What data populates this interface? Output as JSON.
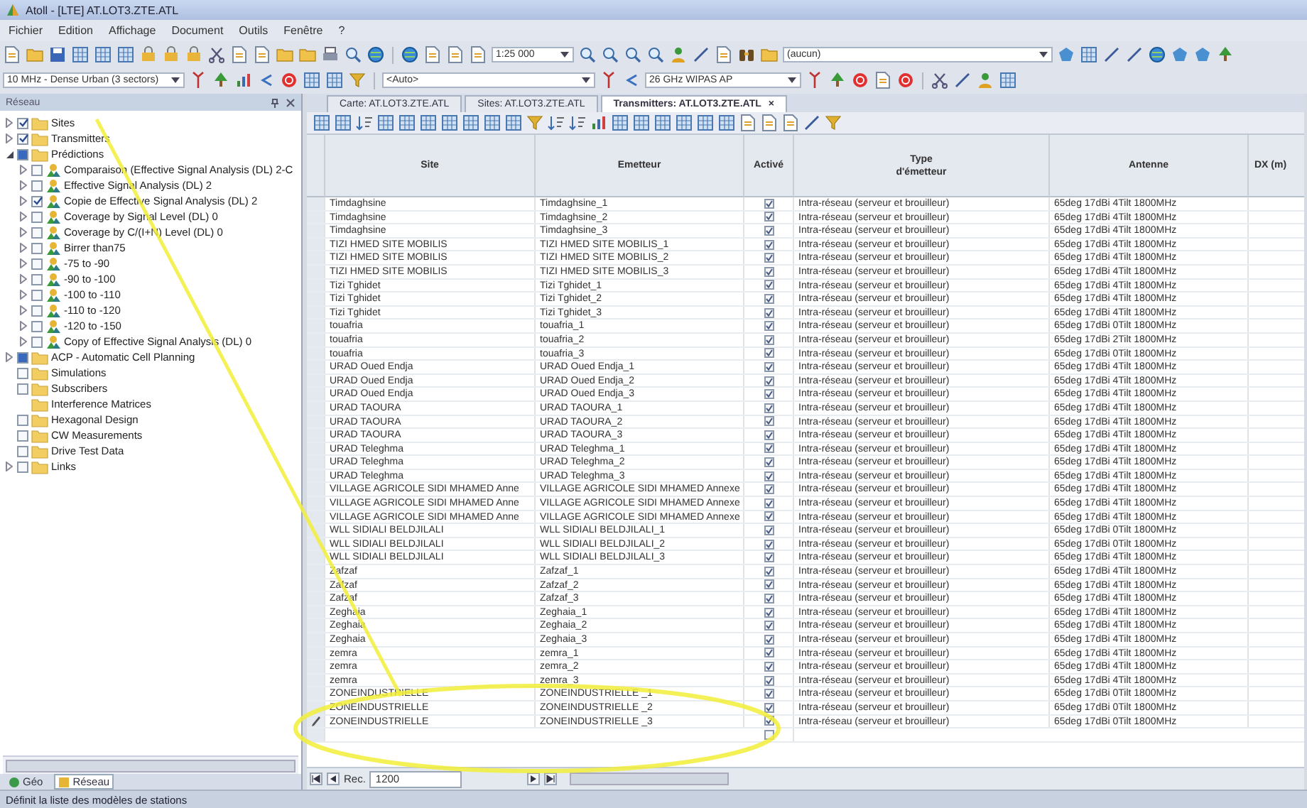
{
  "window": {
    "title": "Atoll - [LTE] AT.LOT3.ZTE.ATL"
  },
  "menu": [
    "Fichier",
    "Edition",
    "Affichage",
    "Document",
    "Outils",
    "Fenêtre",
    "?"
  ],
  "toolbars": {
    "scale": "1:25 000",
    "layer": "(aucun)",
    "environment": "10 MHz - Dense Urban (3 sectors)",
    "auto": "<Auto>",
    "equipment": "26 GHz WIPAS AP"
  },
  "panel": {
    "title": "Réseau",
    "tabs": [
      {
        "label": "Géo",
        "selected": false
      },
      {
        "label": "Réseau",
        "selected": true
      }
    ]
  },
  "tree": [
    {
      "label": "Sites",
      "kind": "folder",
      "checked": true,
      "partial": false,
      "expandable": true,
      "expanded": false
    },
    {
      "label": "Transmitters",
      "kind": "folder",
      "checked": true,
      "partial": false,
      "expandable": true,
      "expanded": false
    },
    {
      "label": "Prédictions",
      "kind": "folder",
      "checked": false,
      "partial": true,
      "expandable": true,
      "expanded": true,
      "children": [
        {
          "label": "Comparaison (Effective Signal Analysis (DL) 2-C",
          "kind": "prediction",
          "checked": false,
          "partial": false,
          "expandable": true,
          "expanded": false
        },
        {
          "label": "Effective Signal Analysis (DL) 2",
          "kind": "prediction",
          "checked": false,
          "partial": false,
          "expandable": true,
          "expanded": false
        },
        {
          "label": "Copie de Effective Signal Analysis (DL) 2",
          "kind": "prediction",
          "checked": true,
          "partial": false,
          "expandable": true,
          "expanded": false
        },
        {
          "label": "Coverage by Signal Level (DL) 0",
          "kind": "prediction",
          "checked": false,
          "partial": false,
          "expandable": true,
          "expanded": false
        },
        {
          "label": "Coverage by C/(I+N) Level (DL) 0",
          "kind": "prediction",
          "checked": false,
          "partial": false,
          "expandable": true,
          "expanded": false
        },
        {
          "label": "Birrer than75",
          "kind": "prediction",
          "checked": false,
          "partial": false,
          "expandable": true,
          "expanded": false
        },
        {
          "label": "-75 to -90",
          "kind": "prediction",
          "checked": false,
          "partial": false,
          "expandable": true,
          "expanded": false
        },
        {
          "label": "-90 to -100",
          "kind": "prediction",
          "checked": false,
          "partial": false,
          "expandable": true,
          "expanded": false
        },
        {
          "label": "-100 to -110",
          "kind": "prediction",
          "checked": false,
          "partial": false,
          "expandable": true,
          "expanded": false
        },
        {
          "label": "-110 to -120",
          "kind": "prediction",
          "checked": false,
          "partial": false,
          "expandable": true,
          "expanded": false
        },
        {
          "label": "-120 to -150",
          "kind": "prediction",
          "checked": false,
          "partial": false,
          "expandable": true,
          "expanded": false
        },
        {
          "label": "Copy of Effective Signal Analysis (DL) 0",
          "kind": "prediction",
          "checked": false,
          "partial": false,
          "expandable": true,
          "expanded": false
        }
      ]
    },
    {
      "label": "ACP - Automatic Cell Planning",
      "kind": "folder",
      "checked": false,
      "partial": true,
      "expandable": true,
      "expanded": false
    },
    {
      "label": "Simulations",
      "kind": "folder",
      "checked": false,
      "partial": false,
      "expandable": false
    },
    {
      "label": "Subscribers",
      "kind": "folder",
      "checked": false,
      "partial": false,
      "expandable": false
    },
    {
      "label": "Interference Matrices",
      "kind": "folder_plain",
      "expandable": false
    },
    {
      "label": "Hexagonal Design",
      "kind": "folder",
      "checked": false,
      "partial": false,
      "expandable": false
    },
    {
      "label": "CW Measurements",
      "kind": "folder",
      "checked": false,
      "partial": false,
      "expandable": false
    },
    {
      "label": "Drive Test Data",
      "kind": "folder",
      "checked": false,
      "partial": false,
      "expandable": false
    },
    {
      "label": "Links",
      "kind": "folder",
      "checked": false,
      "partial": false,
      "expandable": true,
      "expanded": false
    }
  ],
  "doc_tabs": [
    {
      "label": "Carte: AT.LOT3.ZTE.ATL",
      "selected": false
    },
    {
      "label": "Sites: AT.LOT3.ZTE.ATL",
      "selected": false
    },
    {
      "label": "Transmitters: AT.LOT3.ZTE.ATL",
      "selected": true,
      "close": "×"
    }
  ],
  "table": {
    "columns": [
      "Site",
      "Emetteur",
      "Activé",
      "Type\nd'émetteur",
      "Antenne",
      "DX (m)"
    ],
    "rows": [
      {
        "site": "Timdaghsine",
        "emetteur": "Timdaghsine_1",
        "active": true,
        "type": "Intra-réseau (serveur et brouilleur)",
        "antenna": "65deg 17dBi 4Tilt 1800MHz",
        "editing": false
      },
      {
        "site": "Timdaghsine",
        "emetteur": "Timdaghsine_2",
        "active": true,
        "type": "Intra-réseau (serveur et brouilleur)",
        "antenna": "65deg 17dBi 4Tilt 1800MHz",
        "editing": false
      },
      {
        "site": "Timdaghsine",
        "emetteur": "Timdaghsine_3",
        "active": true,
        "type": "Intra-réseau (serveur et brouilleur)",
        "antenna": "65deg 17dBi 4Tilt 1800MHz",
        "editing": false
      },
      {
        "site": "TIZI HMED SITE MOBILIS",
        "emetteur": "TIZI HMED SITE MOBILIS_1",
        "active": true,
        "type": "Intra-réseau (serveur et brouilleur)",
        "antenna": "65deg 17dBi 4Tilt 1800MHz",
        "editing": false
      },
      {
        "site": "TIZI HMED SITE MOBILIS",
        "emetteur": "TIZI HMED SITE MOBILIS_2",
        "active": true,
        "type": "Intra-réseau (serveur et brouilleur)",
        "antenna": "65deg 17dBi 4Tilt 1800MHz",
        "editing": false
      },
      {
        "site": "TIZI HMED SITE MOBILIS",
        "emetteur": "TIZI HMED SITE MOBILIS_3",
        "active": true,
        "type": "Intra-réseau (serveur et brouilleur)",
        "antenna": "65deg 17dBi 4Tilt 1800MHz",
        "editing": false
      },
      {
        "site": "Tizi Tghidet",
        "emetteur": "Tizi Tghidet_1",
        "active": true,
        "type": "Intra-réseau (serveur et brouilleur)",
        "antenna": "65deg 17dBi 4Tilt 1800MHz",
        "editing": false
      },
      {
        "site": "Tizi Tghidet",
        "emetteur": "Tizi Tghidet_2",
        "active": true,
        "type": "Intra-réseau (serveur et brouilleur)",
        "antenna": "65deg 17dBi 4Tilt 1800MHz",
        "editing": false
      },
      {
        "site": "Tizi Tghidet",
        "emetteur": "Tizi Tghidet_3",
        "active": true,
        "type": "Intra-réseau (serveur et brouilleur)",
        "antenna": "65deg 17dBi 4Tilt 1800MHz",
        "editing": false
      },
      {
        "site": "touafria",
        "emetteur": "touafria_1",
        "active": true,
        "type": "Intra-réseau (serveur et brouilleur)",
        "antenna": "65deg 17dBi 0Tilt 1800MHz",
        "editing": false
      },
      {
        "site": "touafria",
        "emetteur": "touafria_2",
        "active": true,
        "type": "Intra-réseau (serveur et brouilleur)",
        "antenna": "65deg 17dBi 2Tilt 1800MHz",
        "editing": false
      },
      {
        "site": "touafria",
        "emetteur": "touafria_3",
        "active": true,
        "type": "Intra-réseau (serveur et brouilleur)",
        "antenna": "65deg 17dBi 0Tilt 1800MHz",
        "editing": false
      },
      {
        "site": "URAD Oued Endja",
        "emetteur": "URAD Oued Endja_1",
        "active": true,
        "type": "Intra-réseau (serveur et brouilleur)",
        "antenna": "65deg 17dBi 4Tilt 1800MHz",
        "editing": false
      },
      {
        "site": "URAD Oued Endja",
        "emetteur": "URAD Oued Endja_2",
        "active": true,
        "type": "Intra-réseau (serveur et brouilleur)",
        "antenna": "65deg 17dBi 4Tilt 1800MHz",
        "editing": false
      },
      {
        "site": "URAD Oued Endja",
        "emetteur": "URAD Oued Endja_3",
        "active": true,
        "type": "Intra-réseau (serveur et brouilleur)",
        "antenna": "65deg 17dBi 4Tilt 1800MHz",
        "editing": false
      },
      {
        "site": "URAD TAOURA",
        "emetteur": "URAD TAOURA_1",
        "active": true,
        "type": "Intra-réseau (serveur et brouilleur)",
        "antenna": "65deg 17dBi 4Tilt 1800MHz",
        "editing": false
      },
      {
        "site": "URAD TAOURA",
        "emetteur": "URAD TAOURA_2",
        "active": true,
        "type": "Intra-réseau (serveur et brouilleur)",
        "antenna": "65deg 17dBi 4Tilt 1800MHz",
        "editing": false
      },
      {
        "site": "URAD TAOURA",
        "emetteur": "URAD TAOURA_3",
        "active": true,
        "type": "Intra-réseau (serveur et brouilleur)",
        "antenna": "65deg 17dBi 4Tilt 1800MHz",
        "editing": false
      },
      {
        "site": "URAD Teleghma",
        "emetteur": "URAD Teleghma_1",
        "active": true,
        "type": "Intra-réseau (serveur et brouilleur)",
        "antenna": "65deg 17dBi 4Tilt 1800MHz",
        "editing": false
      },
      {
        "site": "URAD Teleghma",
        "emetteur": "URAD Teleghma_2",
        "active": true,
        "type": "Intra-réseau (serveur et brouilleur)",
        "antenna": "65deg 17dBi 4Tilt 1800MHz",
        "editing": false
      },
      {
        "site": "URAD Teleghma",
        "emetteur": "URAD Teleghma_3",
        "active": true,
        "type": "Intra-réseau (serveur et brouilleur)",
        "antenna": "65deg 17dBi 4Tilt 1800MHz",
        "editing": false
      },
      {
        "site": "VILLAGE AGRICOLE SIDI MHAMED Anne",
        "emetteur": "VILLAGE AGRICOLE SIDI MHAMED Annexe",
        "active": true,
        "type": "Intra-réseau (serveur et brouilleur)",
        "antenna": "65deg 17dBi 4Tilt 1800MHz",
        "editing": false
      },
      {
        "site": "VILLAGE AGRICOLE SIDI MHAMED Anne",
        "emetteur": "VILLAGE AGRICOLE SIDI MHAMED Annexe",
        "active": true,
        "type": "Intra-réseau (serveur et brouilleur)",
        "antenna": "65deg 17dBi 4Tilt 1800MHz",
        "editing": false
      },
      {
        "site": "VILLAGE AGRICOLE SIDI MHAMED Anne",
        "emetteur": "VILLAGE AGRICOLE SIDI MHAMED Annexe",
        "active": true,
        "type": "Intra-réseau (serveur et brouilleur)",
        "antenna": "65deg 17dBi 4Tilt 1800MHz",
        "editing": false
      },
      {
        "site": "WLL SIDIALI BELDJILALI",
        "emetteur": "WLL SIDIALI BELDJILALI_1",
        "active": true,
        "type": "Intra-réseau (serveur et brouilleur)",
        "antenna": "65deg 17dBi 0Tilt 1800MHz",
        "editing": false
      },
      {
        "site": "WLL SIDIALI BELDJILALI",
        "emetteur": "WLL SIDIALI BELDJILALI_2",
        "active": true,
        "type": "Intra-réseau (serveur et brouilleur)",
        "antenna": "65deg 17dBi 0Tilt 1800MHz",
        "editing": false
      },
      {
        "site": "WLL SIDIALI BELDJILALI",
        "emetteur": "WLL SIDIALI BELDJILALI_3",
        "active": true,
        "type": "Intra-réseau (serveur et brouilleur)",
        "antenna": "65deg 17dBi 4Tilt 1800MHz",
        "editing": false
      },
      {
        "site": "Zafzaf",
        "emetteur": "Zafzaf_1",
        "active": true,
        "type": "Intra-réseau (serveur et brouilleur)",
        "antenna": "65deg 17dBi 4Tilt 1800MHz",
        "editing": false
      },
      {
        "site": "Zafzaf",
        "emetteur": "Zafzaf_2",
        "active": true,
        "type": "Intra-réseau (serveur et brouilleur)",
        "antenna": "65deg 17dBi 4Tilt 1800MHz",
        "editing": false
      },
      {
        "site": "Zafzaf",
        "emetteur": "Zafzaf_3",
        "active": true,
        "type": "Intra-réseau (serveur et brouilleur)",
        "antenna": "65deg 17dBi 4Tilt 1800MHz",
        "editing": false
      },
      {
        "site": "Zeghaia",
        "emetteur": "Zeghaia_1",
        "active": true,
        "type": "Intra-réseau (serveur et brouilleur)",
        "antenna": "65deg 17dBi 4Tilt 1800MHz",
        "editing": false
      },
      {
        "site": "Zeghaia",
        "emetteur": "Zeghaia_2",
        "active": true,
        "type": "Intra-réseau (serveur et brouilleur)",
        "antenna": "65deg 17dBi 4Tilt 1800MHz",
        "editing": false
      },
      {
        "site": "Zeghaia",
        "emetteur": "Zeghaia_3",
        "active": true,
        "type": "Intra-réseau (serveur et brouilleur)",
        "antenna": "65deg 17dBi 4Tilt 1800MHz",
        "editing": false
      },
      {
        "site": "zemra",
        "emetteur": "zemra_1",
        "active": true,
        "type": "Intra-réseau (serveur et brouilleur)",
        "antenna": "65deg 17dBi 4Tilt 1800MHz",
        "editing": false
      },
      {
        "site": "zemra",
        "emetteur": "zemra_2",
        "active": true,
        "type": "Intra-réseau (serveur et brouilleur)",
        "antenna": "65deg 17dBi 4Tilt 1800MHz",
        "editing": false
      },
      {
        "site": "zemra",
        "emetteur": "zemra_3",
        "active": true,
        "type": "Intra-réseau (serveur et brouilleur)",
        "antenna": "65deg 17dBi 4Tilt 1800MHz",
        "editing": false
      },
      {
        "site": "ZONEINDUSTRIELLE",
        "emetteur": "ZONEINDUSTRIELLE _1",
        "active": true,
        "type": "Intra-réseau (serveur et brouilleur)",
        "antenna": "65deg 17dBi 0Tilt 1800MHz",
        "editing": false
      },
      {
        "site": "ZONEINDUSTRIELLE",
        "emetteur": "ZONEINDUSTRIELLE _2",
        "active": true,
        "type": "Intra-réseau (serveur et brouilleur)",
        "antenna": "65deg 17dBi 0Tilt 1800MHz",
        "editing": false
      },
      {
        "site": "ZONEINDUSTRIELLE",
        "emetteur": "ZONEINDUSTRIELLE _3",
        "active": true,
        "type": "Intra-réseau (serveur et brouilleur)",
        "antenna": "65deg 17dBi 0Tilt 1800MHz",
        "editing": true
      }
    ],
    "new_row": {
      "active": false
    }
  },
  "navigator": {
    "label": "Rec.",
    "value": "1200"
  },
  "status_bar": "Définit la liste des modèles de stations"
}
